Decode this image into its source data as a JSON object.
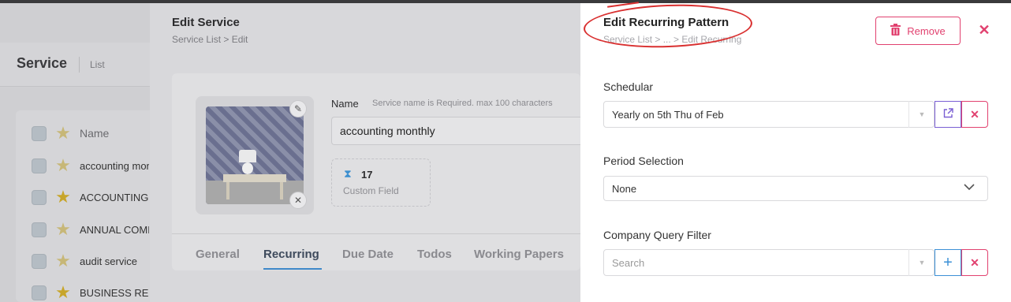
{
  "background_page": {
    "title": "Service",
    "breadcrumb": "List",
    "column_header": "Name",
    "rows": [
      {
        "name": "accounting monthly",
        "starred": false
      },
      {
        "name": "ACCOUNTING",
        "starred": true
      },
      {
        "name": "ANNUAL COMPLIANCE",
        "starred": false
      },
      {
        "name": "audit service",
        "starred": false
      },
      {
        "name": "BUSINESS RES",
        "starred": true
      }
    ]
  },
  "edit_service": {
    "title": "Edit Service",
    "breadcrumb": "Service List  >  Edit",
    "name_label": "Name",
    "name_hint": "Service name is Required. max 100 characters",
    "name_value": "accounting monthly",
    "custom_field_count": "17",
    "custom_field_label": "Custom Field",
    "tabs": [
      "General",
      "Recurring",
      "Due Date",
      "Todos",
      "Working Papers"
    ],
    "active_tab": "Recurring"
  },
  "drawer": {
    "title": "Edit Recurring Pattern",
    "breadcrumb": "Service List  >  ...  >  Edit Recurring",
    "remove_label": "Remove",
    "close_icon": "close-icon",
    "schedular": {
      "label": "Schedular",
      "value": "Yearly on 5th Thu of Feb"
    },
    "period_selection": {
      "label": "Period Selection",
      "value": "None"
    },
    "company_query_filter": {
      "label": "Company Query Filter",
      "placeholder": "Search"
    }
  },
  "colors": {
    "danger": "#e1416f",
    "primary": "#3c90d6",
    "edit": "#7a5fd3",
    "annotation": "#d93030"
  }
}
